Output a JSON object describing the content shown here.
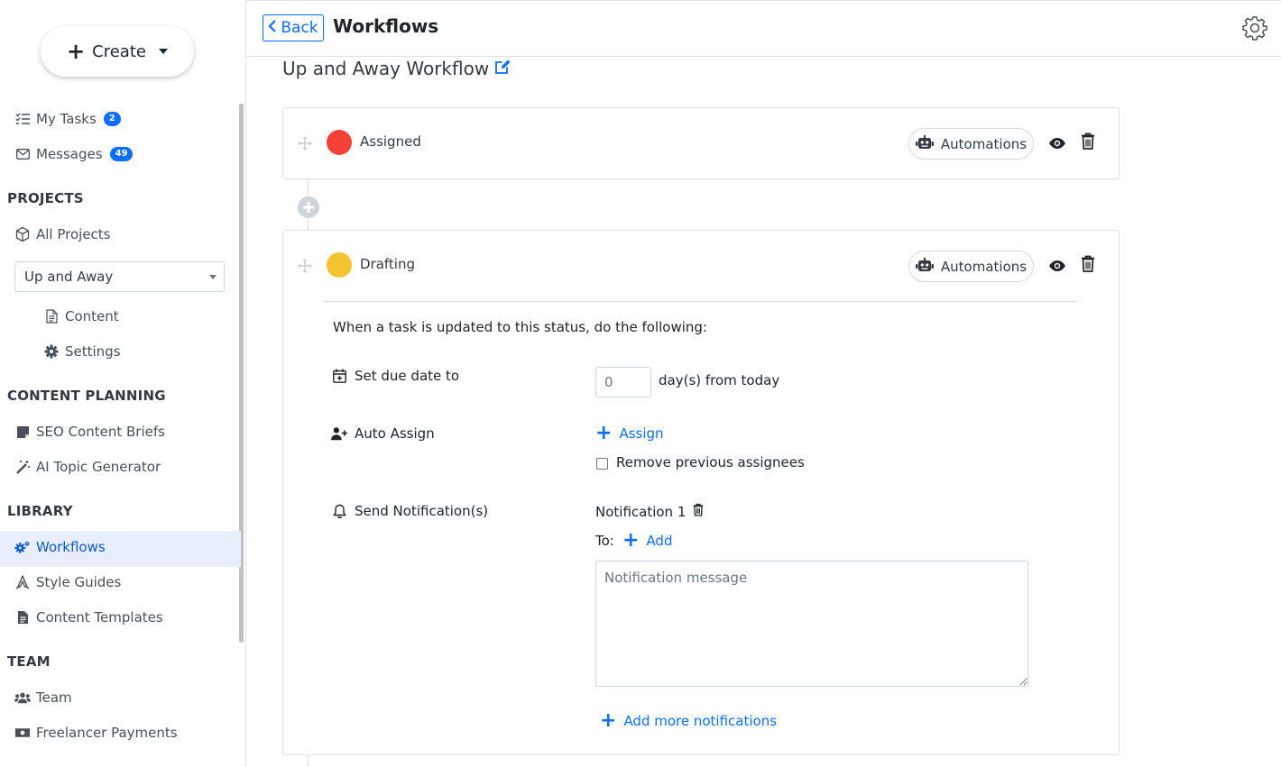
{
  "sidebar": {
    "create_label": "Create",
    "my_tasks": {
      "label": "My Tasks",
      "count": "2"
    },
    "messages": {
      "label": "Messages",
      "count": "49"
    },
    "projects_heading": "PROJECTS",
    "all_projects": "All Projects",
    "project_selected": "Up and Away",
    "content": "Content",
    "settings": "Settings",
    "content_planning_heading": "CONTENT PLANNING",
    "seo_briefs": "SEO Content Briefs",
    "ai_topic": "AI Topic Generator",
    "library_heading": "LIBRARY",
    "workflows": "Workflows",
    "style_guides": "Style Guides",
    "content_templates": "Content Templates",
    "team_heading": "TEAM",
    "team": "Team",
    "freelancer_payments": "Freelancer Payments"
  },
  "header": {
    "back_label": "Back",
    "title": "Workflows"
  },
  "workflow": {
    "name": "Up and Away Workflow",
    "statuses": [
      {
        "label": "Assigned",
        "color": "#f44336",
        "automations_label": "Automations"
      },
      {
        "label": "Drafting",
        "color": "#f4c430",
        "automations_label": "Automations"
      }
    ],
    "automation": {
      "intro": "When a task is updated to this status, do the following:",
      "due_date_label": "Set due date to",
      "due_days_placeholder": "0",
      "due_days_suffix": "day(s) from today",
      "auto_assign_label": "Auto Assign",
      "assign_link": "Assign",
      "remove_previous_label": "Remove previous assignees",
      "send_notifications_label": "Send Notification(s)",
      "notification_title": "Notification 1",
      "to_label": "To:",
      "add_link": "Add",
      "message_placeholder": "Notification message",
      "add_more_link": "Add more notifications"
    }
  },
  "colors": {
    "accent": "#0d6efd",
    "active_bg": "#e8eefb"
  }
}
